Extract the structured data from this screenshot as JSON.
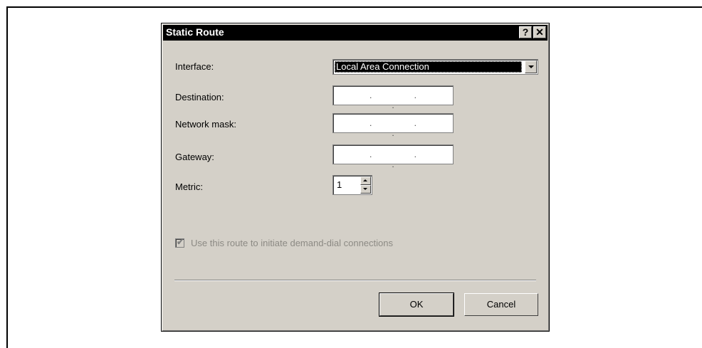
{
  "dialog": {
    "title": "Static Route",
    "help_button": "?",
    "close_button": "✕"
  },
  "form": {
    "interface_label": "Interface:",
    "interface_value": "Local Area Connection",
    "destination_label": "Destination:",
    "destination_value": ". . .",
    "network_mask_label": "Network mask:",
    "network_mask_value": ". . .",
    "gateway_label": "Gateway:",
    "gateway_value": ". . .",
    "metric_label": "Metric:",
    "metric_value": "1",
    "demand_dial_label": "Use this route to initiate demand-dial connections",
    "demand_dial_checked": true
  },
  "buttons": {
    "ok": "OK",
    "cancel": "Cancel"
  }
}
